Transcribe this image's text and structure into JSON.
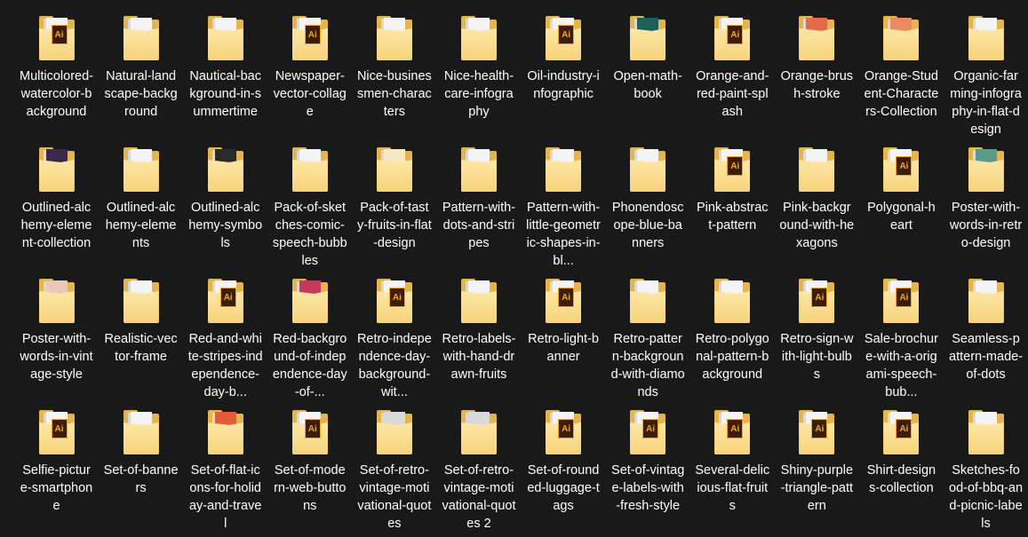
{
  "folders": [
    {
      "name": "Multicolored-watercolor-background",
      "icon": "ai-badge",
      "thumb": "#f4f4f4"
    },
    {
      "name": "Natural-landscape-background",
      "icon": "paper",
      "thumb": "#f4f4f4"
    },
    {
      "name": "Nautical-background-in-summertime",
      "icon": "paper",
      "thumb": "#f4f4f4"
    },
    {
      "name": "Newspaper-vector-collage",
      "icon": "ai-badge",
      "thumb": "#f4f4f4"
    },
    {
      "name": "Nice-businessmen-characters",
      "icon": "paper",
      "thumb": "#f4f4f4"
    },
    {
      "name": "Nice-health-care-infography",
      "icon": "paper",
      "thumb": "#f4f4f4"
    },
    {
      "name": "Oil-industry-infographic",
      "icon": "ai-badge",
      "thumb": "#f4f4f4"
    },
    {
      "name": "Open-math-book",
      "icon": "paper",
      "thumb": "#1f5f5a"
    },
    {
      "name": "Orange-and-red-paint-splash",
      "icon": "ai-badge",
      "thumb": "#f4f4f4"
    },
    {
      "name": "Orange-brush-stroke",
      "icon": "paper",
      "thumb": "#e46a4b"
    },
    {
      "name": "Orange-Student-Characters-Collection",
      "icon": "paper",
      "thumb": "#e98a63"
    },
    {
      "name": "Organic-farming-infography-in-flat-design",
      "icon": "paper",
      "thumb": "#f4f4f4"
    },
    {
      "name": "Outlined-alchemy-element-collection",
      "icon": "paper",
      "thumb": "#3a2a4a"
    },
    {
      "name": "Outlined-alchemy-elements",
      "icon": "paper",
      "thumb": "#f4f4f4"
    },
    {
      "name": "Outlined-alchemy-symbols",
      "icon": "paper",
      "thumb": "#2a2a2a"
    },
    {
      "name": "Pack-of-sketches-comic-speech-bubbles",
      "icon": "paper",
      "thumb": "#f4f4f4"
    },
    {
      "name": "Pack-of-tasty-fruits-in-flat-design",
      "icon": "paper",
      "thumb": "#f6e8c4"
    },
    {
      "name": "Pattern-with-dots-and-stripes",
      "icon": "paper",
      "thumb": "#f4f4f4"
    },
    {
      "name": "Pattern-with-little-geometric-shapes-in-bl...",
      "icon": "paper",
      "thumb": "#f4f4f4"
    },
    {
      "name": "Phonendoscope-blue-banners",
      "icon": "paper",
      "thumb": "#f4f4f4"
    },
    {
      "name": "Pink-abstract-pattern",
      "icon": "ai-badge",
      "thumb": "#f4f4f4"
    },
    {
      "name": "Pink-background-with-hexagons",
      "icon": "paper",
      "thumb": "#f4f4f4"
    },
    {
      "name": "Polygonal-heart",
      "icon": "ai-badge",
      "thumb": "#f4f4f4"
    },
    {
      "name": "Poster-with-words-in-retro-design",
      "icon": "paper",
      "thumb": "#5c9a8a"
    },
    {
      "name": "Poster-with-words-in-vintage-style",
      "icon": "paper",
      "thumb": "#e8c9b8"
    },
    {
      "name": "Realistic-vector-frame",
      "icon": "paper",
      "thumb": "#f4f4f4"
    },
    {
      "name": "Red-and-white-stripes-independence-day-b...",
      "icon": "ai-badge",
      "thumb": "#f4f4f4"
    },
    {
      "name": "Red-background-of-independence-day-of-...",
      "icon": "paper",
      "thumb": "#c43a5a"
    },
    {
      "name": "Retro-independence-day-background-wit...",
      "icon": "ai-badge",
      "thumb": "#f4f4f4"
    },
    {
      "name": "Retro-labels-with-hand-drawn-fruits",
      "icon": "paper",
      "thumb": "#f4f4f4"
    },
    {
      "name": "Retro-light-banner",
      "icon": "ai-badge",
      "thumb": "#f4f4f4"
    },
    {
      "name": "Retro-pattern-background-with-diamonds",
      "icon": "paper",
      "thumb": "#f4f4f4"
    },
    {
      "name": "Retro-polygonal-pattern-background",
      "icon": "paper",
      "thumb": "#f4f4f4"
    },
    {
      "name": "Retro-sign-with-light-bulbs",
      "icon": "ai-badge",
      "thumb": "#f4f4f4"
    },
    {
      "name": "Sale-brochure-with-a-origami-speech-bub...",
      "icon": "ai-badge",
      "thumb": "#f4f4f4"
    },
    {
      "name": "Seamless-pattern-made-of-dots",
      "icon": "paper",
      "thumb": "#f4f4f4"
    },
    {
      "name": "Selfie-picture-smartphone",
      "icon": "ai-badge",
      "thumb": "#f4f4f4"
    },
    {
      "name": "Set-of-banners",
      "icon": "paper",
      "thumb": "#f4f4f4"
    },
    {
      "name": "Set-of-flat-icons-for-holiday-and-travel",
      "icon": "paper",
      "thumb": "#e45b3a"
    },
    {
      "name": "Set-of-modern-web-buttons",
      "icon": "ai-badge",
      "thumb": "#f4f4f4"
    },
    {
      "name": "Set-of-retro-vintage-motivational-quotes",
      "icon": "paper",
      "thumb": "#d9d9d9"
    },
    {
      "name": "Set-of-retro-vintage-motivational-quotes 2",
      "icon": "paper",
      "thumb": "#d9d9d9"
    },
    {
      "name": "Set-of-rounded-luggage-tags",
      "icon": "ai-badge",
      "thumb": "#f4f4f4"
    },
    {
      "name": "Set-of-vintage-labels-with-fresh-style",
      "icon": "ai-badge",
      "thumb": "#f4f4f4"
    },
    {
      "name": "Several-delicious-flat-fruits",
      "icon": "ai-badge",
      "thumb": "#f4f4f4"
    },
    {
      "name": "Shiny-purple-triangle-pattern",
      "icon": "ai-badge",
      "thumb": "#f4f4f4"
    },
    {
      "name": "Shirt-designs-collection",
      "icon": "ai-badge",
      "thumb": "#f4f4f4"
    },
    {
      "name": "Sketches-food-of-bbq-and-picnic-labels",
      "icon": "paper",
      "thumb": "#f4f4f4"
    }
  ],
  "ai_badge_text": "Ai",
  "colors": {
    "background": "#191919",
    "folder_back": "#e5b54b",
    "folder_front": "#f7d37a",
    "ai_badge_bg": "#3b1f05",
    "ai_badge_fg": "#f4a51c",
    "label_text": "#ffffff"
  }
}
